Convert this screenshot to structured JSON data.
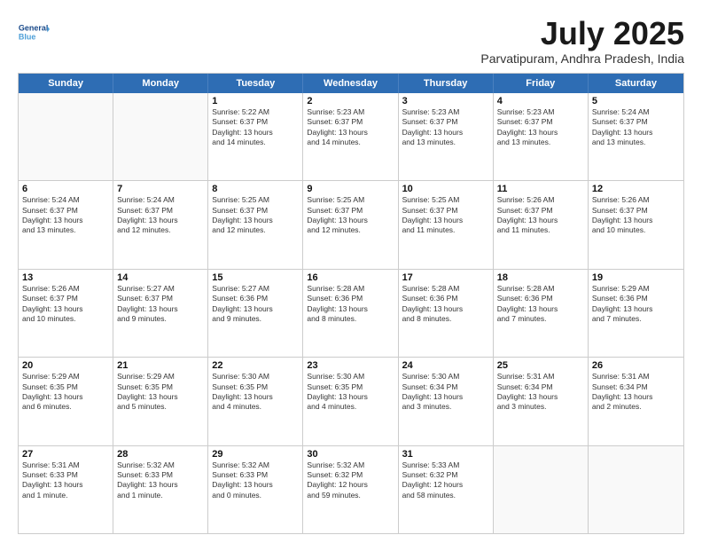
{
  "logo": {
    "line1": "General",
    "line2": "Blue"
  },
  "title": "July 2025",
  "location": "Parvatipuram, Andhra Pradesh, India",
  "header_days": [
    "Sunday",
    "Monday",
    "Tuesday",
    "Wednesday",
    "Thursday",
    "Friday",
    "Saturday"
  ],
  "weeks": [
    [
      {
        "day": "",
        "lines": []
      },
      {
        "day": "",
        "lines": []
      },
      {
        "day": "1",
        "lines": [
          "Sunrise: 5:22 AM",
          "Sunset: 6:37 PM",
          "Daylight: 13 hours",
          "and 14 minutes."
        ]
      },
      {
        "day": "2",
        "lines": [
          "Sunrise: 5:23 AM",
          "Sunset: 6:37 PM",
          "Daylight: 13 hours",
          "and 14 minutes."
        ]
      },
      {
        "day": "3",
        "lines": [
          "Sunrise: 5:23 AM",
          "Sunset: 6:37 PM",
          "Daylight: 13 hours",
          "and 13 minutes."
        ]
      },
      {
        "day": "4",
        "lines": [
          "Sunrise: 5:23 AM",
          "Sunset: 6:37 PM",
          "Daylight: 13 hours",
          "and 13 minutes."
        ]
      },
      {
        "day": "5",
        "lines": [
          "Sunrise: 5:24 AM",
          "Sunset: 6:37 PM",
          "Daylight: 13 hours",
          "and 13 minutes."
        ]
      }
    ],
    [
      {
        "day": "6",
        "lines": [
          "Sunrise: 5:24 AM",
          "Sunset: 6:37 PM",
          "Daylight: 13 hours",
          "and 13 minutes."
        ]
      },
      {
        "day": "7",
        "lines": [
          "Sunrise: 5:24 AM",
          "Sunset: 6:37 PM",
          "Daylight: 13 hours",
          "and 12 minutes."
        ]
      },
      {
        "day": "8",
        "lines": [
          "Sunrise: 5:25 AM",
          "Sunset: 6:37 PM",
          "Daylight: 13 hours",
          "and 12 minutes."
        ]
      },
      {
        "day": "9",
        "lines": [
          "Sunrise: 5:25 AM",
          "Sunset: 6:37 PM",
          "Daylight: 13 hours",
          "and 12 minutes."
        ]
      },
      {
        "day": "10",
        "lines": [
          "Sunrise: 5:25 AM",
          "Sunset: 6:37 PM",
          "Daylight: 13 hours",
          "and 11 minutes."
        ]
      },
      {
        "day": "11",
        "lines": [
          "Sunrise: 5:26 AM",
          "Sunset: 6:37 PM",
          "Daylight: 13 hours",
          "and 11 minutes."
        ]
      },
      {
        "day": "12",
        "lines": [
          "Sunrise: 5:26 AM",
          "Sunset: 6:37 PM",
          "Daylight: 13 hours",
          "and 10 minutes."
        ]
      }
    ],
    [
      {
        "day": "13",
        "lines": [
          "Sunrise: 5:26 AM",
          "Sunset: 6:37 PM",
          "Daylight: 13 hours",
          "and 10 minutes."
        ]
      },
      {
        "day": "14",
        "lines": [
          "Sunrise: 5:27 AM",
          "Sunset: 6:37 PM",
          "Daylight: 13 hours",
          "and 9 minutes."
        ]
      },
      {
        "day": "15",
        "lines": [
          "Sunrise: 5:27 AM",
          "Sunset: 6:36 PM",
          "Daylight: 13 hours",
          "and 9 minutes."
        ]
      },
      {
        "day": "16",
        "lines": [
          "Sunrise: 5:28 AM",
          "Sunset: 6:36 PM",
          "Daylight: 13 hours",
          "and 8 minutes."
        ]
      },
      {
        "day": "17",
        "lines": [
          "Sunrise: 5:28 AM",
          "Sunset: 6:36 PM",
          "Daylight: 13 hours",
          "and 8 minutes."
        ]
      },
      {
        "day": "18",
        "lines": [
          "Sunrise: 5:28 AM",
          "Sunset: 6:36 PM",
          "Daylight: 13 hours",
          "and 7 minutes."
        ]
      },
      {
        "day": "19",
        "lines": [
          "Sunrise: 5:29 AM",
          "Sunset: 6:36 PM",
          "Daylight: 13 hours",
          "and 7 minutes."
        ]
      }
    ],
    [
      {
        "day": "20",
        "lines": [
          "Sunrise: 5:29 AM",
          "Sunset: 6:35 PM",
          "Daylight: 13 hours",
          "and 6 minutes."
        ]
      },
      {
        "day": "21",
        "lines": [
          "Sunrise: 5:29 AM",
          "Sunset: 6:35 PM",
          "Daylight: 13 hours",
          "and 5 minutes."
        ]
      },
      {
        "day": "22",
        "lines": [
          "Sunrise: 5:30 AM",
          "Sunset: 6:35 PM",
          "Daylight: 13 hours",
          "and 4 minutes."
        ]
      },
      {
        "day": "23",
        "lines": [
          "Sunrise: 5:30 AM",
          "Sunset: 6:35 PM",
          "Daylight: 13 hours",
          "and 4 minutes."
        ]
      },
      {
        "day": "24",
        "lines": [
          "Sunrise: 5:30 AM",
          "Sunset: 6:34 PM",
          "Daylight: 13 hours",
          "and 3 minutes."
        ]
      },
      {
        "day": "25",
        "lines": [
          "Sunrise: 5:31 AM",
          "Sunset: 6:34 PM",
          "Daylight: 13 hours",
          "and 3 minutes."
        ]
      },
      {
        "day": "26",
        "lines": [
          "Sunrise: 5:31 AM",
          "Sunset: 6:34 PM",
          "Daylight: 13 hours",
          "and 2 minutes."
        ]
      }
    ],
    [
      {
        "day": "27",
        "lines": [
          "Sunrise: 5:31 AM",
          "Sunset: 6:33 PM",
          "Daylight: 13 hours",
          "and 1 minute."
        ]
      },
      {
        "day": "28",
        "lines": [
          "Sunrise: 5:32 AM",
          "Sunset: 6:33 PM",
          "Daylight: 13 hours",
          "and 1 minute."
        ]
      },
      {
        "day": "29",
        "lines": [
          "Sunrise: 5:32 AM",
          "Sunset: 6:33 PM",
          "Daylight: 13 hours",
          "and 0 minutes."
        ]
      },
      {
        "day": "30",
        "lines": [
          "Sunrise: 5:32 AM",
          "Sunset: 6:32 PM",
          "Daylight: 12 hours",
          "and 59 minutes."
        ]
      },
      {
        "day": "31",
        "lines": [
          "Sunrise: 5:33 AM",
          "Sunset: 6:32 PM",
          "Daylight: 12 hours",
          "and 58 minutes."
        ]
      },
      {
        "day": "",
        "lines": []
      },
      {
        "day": "",
        "lines": []
      }
    ]
  ]
}
